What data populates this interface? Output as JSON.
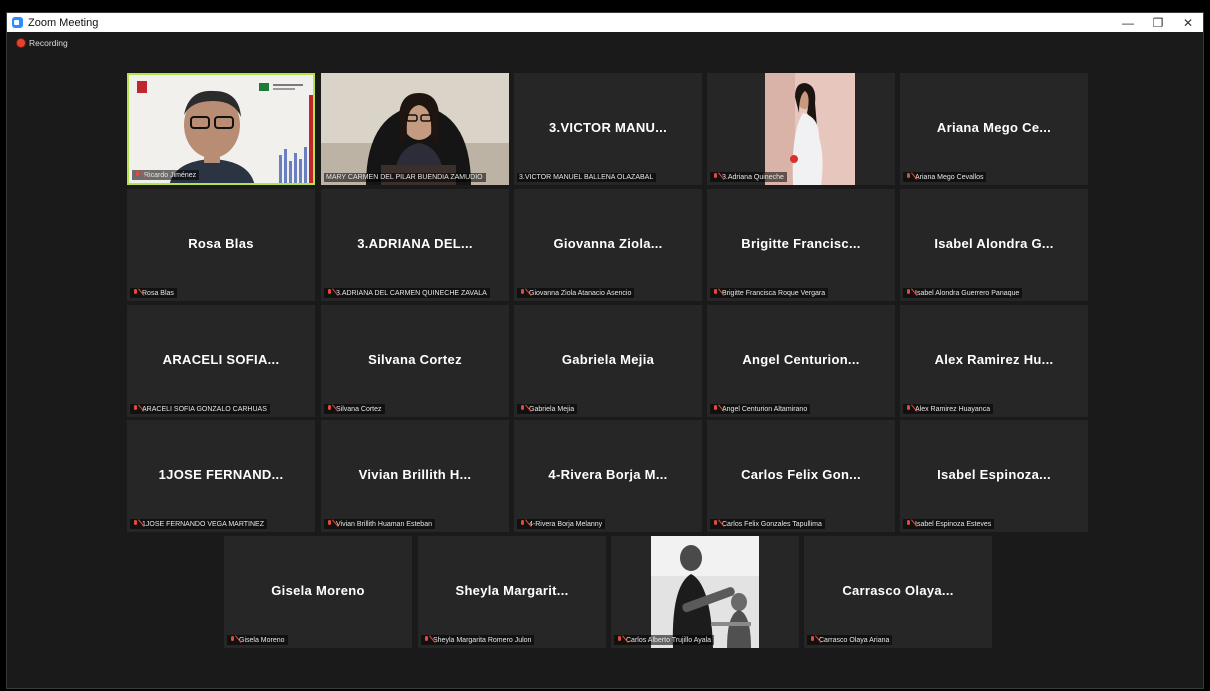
{
  "window": {
    "title": "Zoom Meeting",
    "controls": {
      "minimize": "—",
      "maximize": "❐",
      "close": "✕"
    }
  },
  "recording": {
    "label": "Recording"
  },
  "colors": {
    "active_speaker_border": "#b5e34f",
    "muted_mic": "#e24a3b",
    "tile_bg": "#262626"
  },
  "participants": [
    {
      "name": "Ricardo Jiménez",
      "label": "Ricardo Jiménez",
      "video": true,
      "active": true,
      "muted": true
    },
    {
      "name": "MARY CARMEN DEL PILAR BUENDIA ZAMUDIO",
      "label": "MARY CARMEN DEL PILAR BUENDIA ZAMUDIO",
      "video": true,
      "muted": false
    },
    {
      "name": "3.VICTOR MANU...",
      "label": "3.VICTOR MANUEL BALLENA OLAZABAL",
      "video": false,
      "muted": false
    },
    {
      "name": "3.Adriana Quineche",
      "label": "3.Adriana Quineche",
      "video": true,
      "muted": true
    },
    {
      "name": "Ariana Mego Ce...",
      "label": "Ariana Mego Cevallos",
      "video": false,
      "muted": true
    },
    {
      "name": "Rosa Blas",
      "label": "Rosa Blas",
      "video": false,
      "muted": true
    },
    {
      "name": "3.ADRIANA DEL...",
      "label": "3.ADRIANA DEL CARMEN QUINECHE ZAVALA",
      "video": false,
      "muted": true
    },
    {
      "name": "Giovanna Ziola...",
      "label": "Giovanna Ziola Atanacio Asencio",
      "video": false,
      "muted": true
    },
    {
      "name": "Brigitte Francisc...",
      "label": "Brigitte Francisca Roque Vergara",
      "video": false,
      "muted": true
    },
    {
      "name": "Isabel Alondra G...",
      "label": "Isabel Alondra Guerrero Panaque",
      "video": false,
      "muted": true
    },
    {
      "name": "ARACELI SOFIA...",
      "label": "ARACELI SOFIA GONZALO CARHUAS",
      "video": false,
      "muted": true
    },
    {
      "name": "Silvana Cortez",
      "label": "Silvana Cortez",
      "video": false,
      "muted": true
    },
    {
      "name": "Gabriela Mejia",
      "label": "Gabriela Mejia",
      "video": false,
      "muted": true
    },
    {
      "name": "Angel Centurion...",
      "label": "Angel Centurion Altamirano",
      "video": false,
      "muted": true
    },
    {
      "name": "Alex Ramirez Hu...",
      "label": "Alex Ramirez Huayanca",
      "video": false,
      "muted": true
    },
    {
      "name": "1JOSE FERNAND...",
      "label": "1JOSE FERNANDO VEGA MARTINEZ",
      "video": false,
      "muted": true
    },
    {
      "name": "Vivian Brillith H...",
      "label": "Vivian Brillith Huaman Esteban",
      "video": false,
      "muted": true
    },
    {
      "name": "4-Rivera Borja M...",
      "label": "4-Rivera Borja Melanny",
      "video": false,
      "muted": true
    },
    {
      "name": "Carlos Felix Gon...",
      "label": "Carlos Felix Gonzales Tapullima",
      "video": false,
      "muted": true
    },
    {
      "name": "Isabel Espinoza...",
      "label": "Isabel Espinoza Esteves",
      "video": false,
      "muted": true
    },
    {
      "name": "Gisela Moreno",
      "label": "Gisela Moreno",
      "video": false,
      "muted": true
    },
    {
      "name": "Sheyla Margarit...",
      "label": "Sheyla Margarita Romero Julon",
      "video": false,
      "muted": true
    },
    {
      "name": "Carlos Alberto Trujillo Ayala",
      "label": "Carlos Alberto Trujillo Ayala",
      "video": true,
      "muted": true
    },
    {
      "name": "Carrasco Olaya...",
      "label": "Carrasco Olaya Ariana",
      "video": false,
      "muted": true
    }
  ]
}
